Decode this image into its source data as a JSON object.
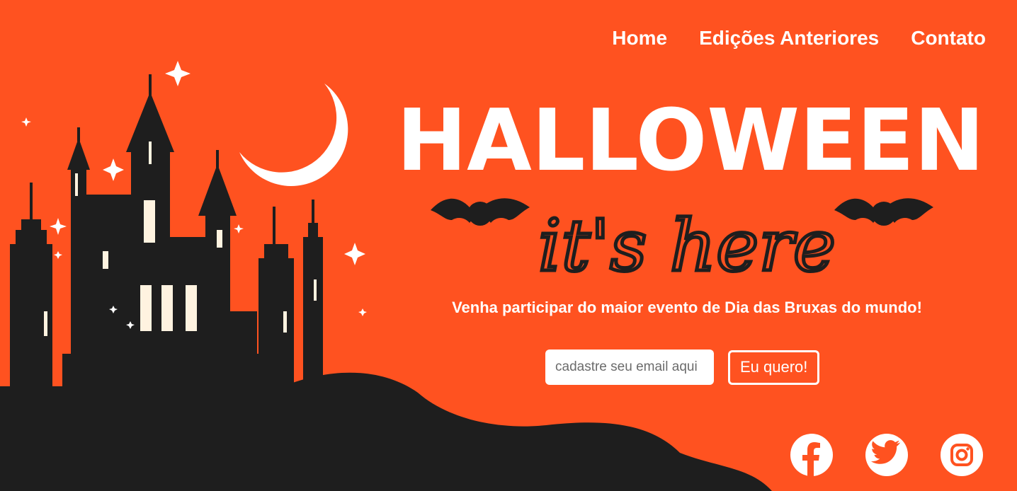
{
  "nav": {
    "items": [
      {
        "label": "Home"
      },
      {
        "label": "Edições Anteriores"
      },
      {
        "label": "Contato"
      }
    ]
  },
  "hero": {
    "title": "HALLOWEEN",
    "subtitle": "it's here",
    "tagline": "Venha participar do maior evento de Dia das Bruxas do mundo!"
  },
  "signup": {
    "email_placeholder": "cadastre seu email aqui",
    "button_label": "Eu quero!"
  },
  "socials": [
    {
      "icon": "facebook-icon"
    },
    {
      "icon": "twitter-icon"
    },
    {
      "icon": "instagram-icon"
    }
  ],
  "colors": {
    "background": "#ff5220",
    "silhouette": "#1e1e1e",
    "light": "#ffffff",
    "window_light": "#fff3e0"
  }
}
